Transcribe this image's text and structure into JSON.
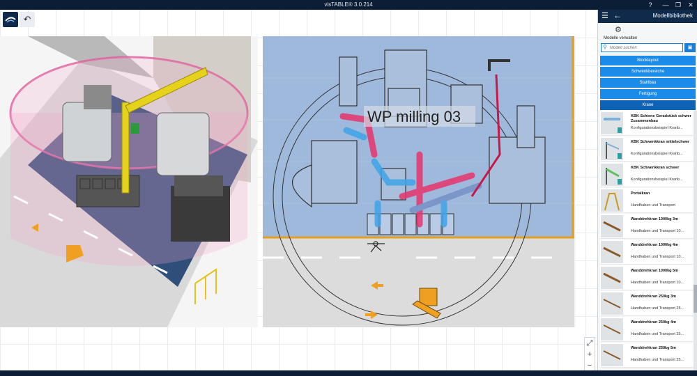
{
  "window": {
    "title": "visTABLE® 3.0.214",
    "help_icon": "help-icon",
    "minimize": "—",
    "maximize": "❐",
    "close": "✕"
  },
  "toolbar": {
    "logo_icon": "vistable-logo-icon",
    "undo_icon": "undo-icon"
  },
  "canvas": {
    "label_2d": "WP milling 03",
    "zoom_in": "+",
    "zoom_out": "−",
    "fit_icon": "fit-view-icon"
  },
  "panel": {
    "title": "Modellbibliothek",
    "manage_label": "Modelle verwalten",
    "search_placeholder": "Modell suchen",
    "categories": [
      {
        "label": "Blocklayout"
      },
      {
        "label": "Schwenkbereiche"
      },
      {
        "label": "Stahlbau"
      },
      {
        "label": "Fertigung"
      },
      {
        "label": "Krane"
      }
    ],
    "models": [
      {
        "name": "KBK Schiene Geradstück schwer Zusammenbau",
        "desc": "Konfigurationsbeispiel Kranb..."
      },
      {
        "name": "KBK Schwenkkran mittelschwer",
        "desc": "Konfigurationsbeispiel Kranb..."
      },
      {
        "name": "KBK Schwenkkran schwer",
        "desc": "Konfigurationsbeispiel Kranb..."
      },
      {
        "name": "Portalkran",
        "desc": "Handhaben und Transport"
      },
      {
        "name": "Wanddrehkran 1000kg 3m",
        "desc": "Handhaben und Transport 10..."
      },
      {
        "name": "Wanddrehkran 1000kg 4m",
        "desc": "Handhaben und Transport 10..."
      },
      {
        "name": "Wanddrehkran 1000kg 5m",
        "desc": "Handhaben und Transport 10..."
      },
      {
        "name": "Wanddrehkran 250kg 3m",
        "desc": "Handhaben und Transport 25..."
      },
      {
        "name": "Wanddrehkran 250kg 4m",
        "desc": "Handhaben und Transport 25..."
      },
      {
        "name": "Wanddrehkran 250kg 5m",
        "desc": "Handhaben und Transport 25..."
      }
    ]
  },
  "colors": {
    "titlebar": "#0b1e36",
    "accent": "#1a8be8",
    "accent_active": "#0e63b6",
    "plan_blue": "#9fb9dd",
    "floor_gray": "#dcdcdc",
    "flow_pink": "#e8356c",
    "flow_blue": "#3fa4e8",
    "crane_yellow": "#e6d21a",
    "lane_orange": "#f0a020"
  }
}
